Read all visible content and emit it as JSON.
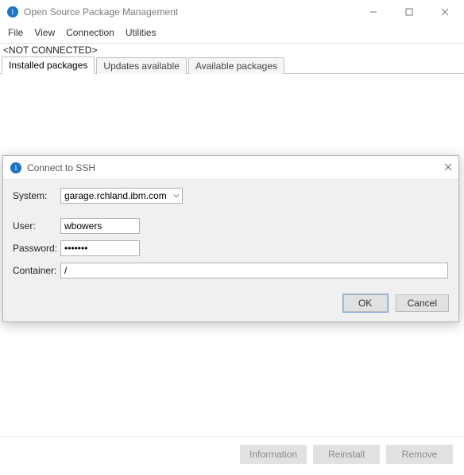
{
  "window": {
    "title": "Open Source Package Management"
  },
  "menu": {
    "file": "File",
    "view": "View",
    "connection": "Connection",
    "utilities": "Utilities"
  },
  "status": {
    "text": "<NOT CONNECTED>"
  },
  "tabs": {
    "installed": "Installed packages",
    "updates": "Updates available",
    "available": "Available packages"
  },
  "footer": {
    "information": "Information",
    "reinstall": "Reinstall",
    "remove": "Remove"
  },
  "dialog": {
    "title": "Connect to SSH",
    "labels": {
      "system": "System:",
      "user": "User:",
      "password": "Password:",
      "container": "Container:"
    },
    "values": {
      "system": "garage.rchland.ibm.com",
      "user": "wbowers",
      "password": "•••••••",
      "container": "/"
    },
    "buttons": {
      "ok": "OK",
      "cancel": "Cancel"
    }
  }
}
